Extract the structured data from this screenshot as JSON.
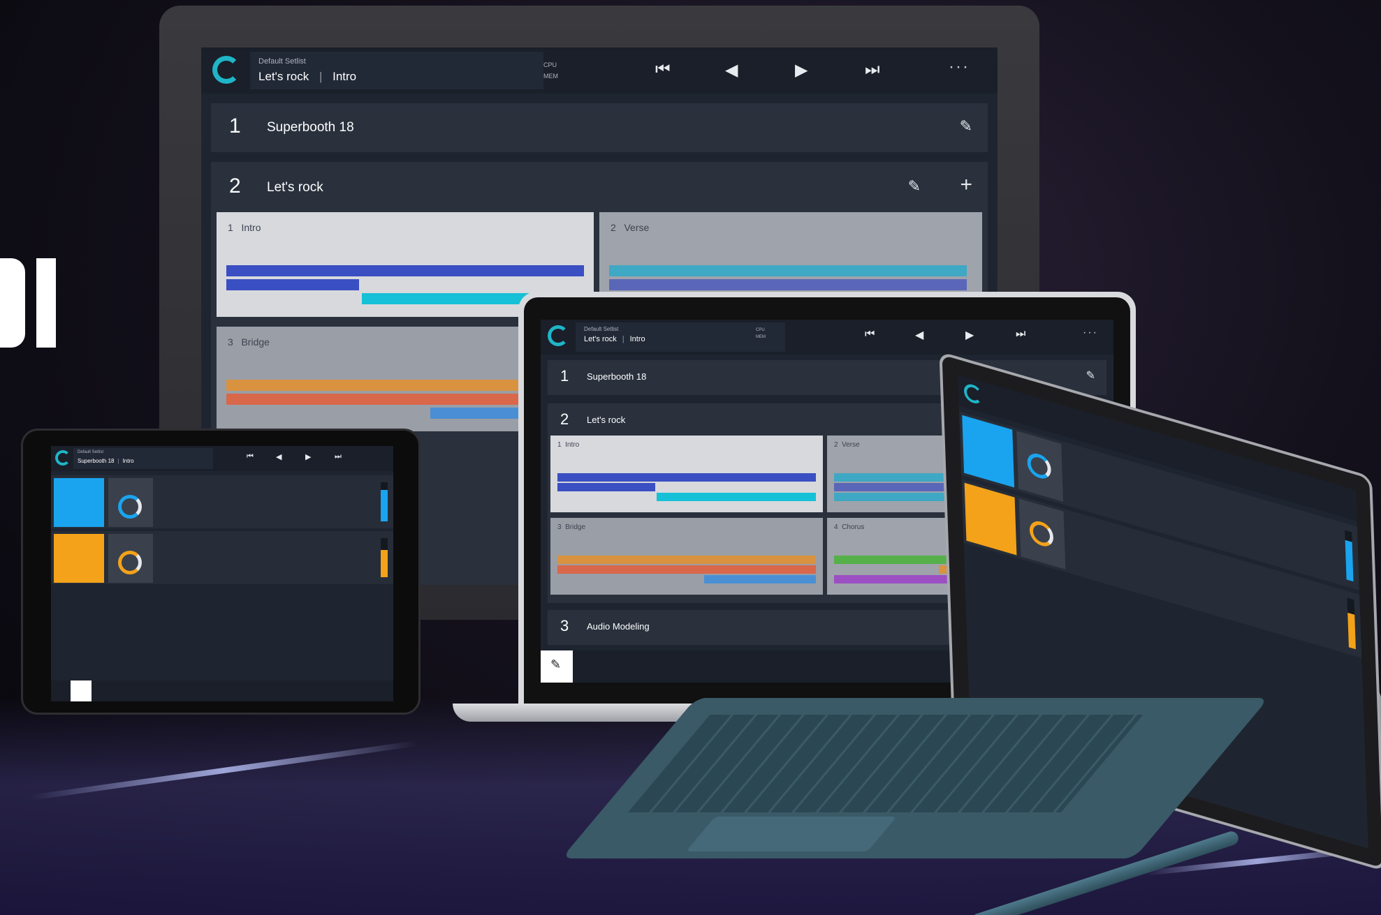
{
  "app": {
    "setlist_label": "Default Setlist",
    "current_song": "Let's rock",
    "current_part": "Intro",
    "cpu_label": "CPU",
    "mem_label": "MEM",
    "more_label": "···"
  },
  "transport": {
    "prev_song_icon": "skip-back-icon",
    "rewind_icon": "rewind-icon",
    "play_icon": "play-icon",
    "next_song_icon": "skip-forward-icon"
  },
  "songs": [
    {
      "number": "1",
      "name": "Superbooth 18"
    },
    {
      "number": "2",
      "name": "Let's rock"
    },
    {
      "number": "3",
      "name": "Audio Modeling"
    }
  ],
  "parts": [
    {
      "number": "1",
      "name": "Intro"
    },
    {
      "number": "2",
      "name": "Verse"
    },
    {
      "number": "3",
      "name": "Bridge"
    },
    {
      "number": "4",
      "name": "Chorus"
    }
  ],
  "colors": {
    "accent": "#1fb5c7",
    "blue_bar": "#3a4fc2",
    "cyan_bar": "#16c0d6",
    "orange_bar": "#d99240",
    "red_bar": "#d9674a",
    "lightblue_bar": "#4a8fd4",
    "green_bar": "#55b04a",
    "purple_bar": "#9b4fc2",
    "pad_blue": "#1aa4ef",
    "pad_orange": "#f4a21a"
  },
  "icons": {
    "edit": "pencil-icon",
    "add": "plus-icon",
    "logo": "camelot-logo-icon"
  },
  "glyphs": {
    "prev": "⏮",
    "rewind": "◀",
    "play": "▶",
    "next": "⏭",
    "pencil": "✎",
    "plus": "+",
    "logo": "C"
  }
}
